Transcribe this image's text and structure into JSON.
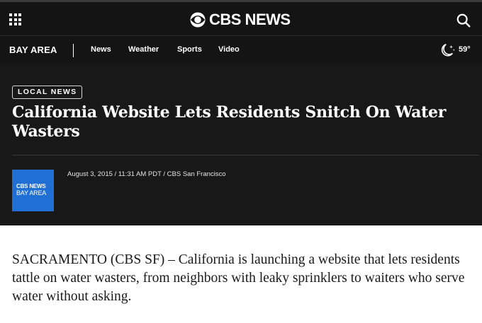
{
  "header": {
    "brand": "CBS NEWS",
    "menu_icon": "grid-menu-icon",
    "logo_icon": "cbs-eye-icon",
    "search_icon": "search-icon"
  },
  "nav": {
    "region": "BAY AREA",
    "items": [
      "News",
      "Weather",
      "Sports",
      "Video"
    ],
    "weather_icon": "moon-stars-icon",
    "temperature": "59°"
  },
  "article": {
    "category": "LOCAL NEWS",
    "headline": "California Website Lets Residents Snitch On Water Wasters",
    "source_logo": {
      "line1": "CBS NEWS",
      "line2": "BAY AREA"
    },
    "meta": "August 3, 2015 / 11:31 AM PDT / CBS San Francisco",
    "body": "SACRAMENTO (CBS SF) – California is launching a website that lets residents tattle on water wasters, from neighbors with leaky sprinklers to waiters who serve water without asking."
  },
  "colors": {
    "header_bg": "#141414",
    "hero_bg": "#181818",
    "source_logo_bg": "#1f6fd4",
    "text_dark": "#1a1a1a"
  }
}
